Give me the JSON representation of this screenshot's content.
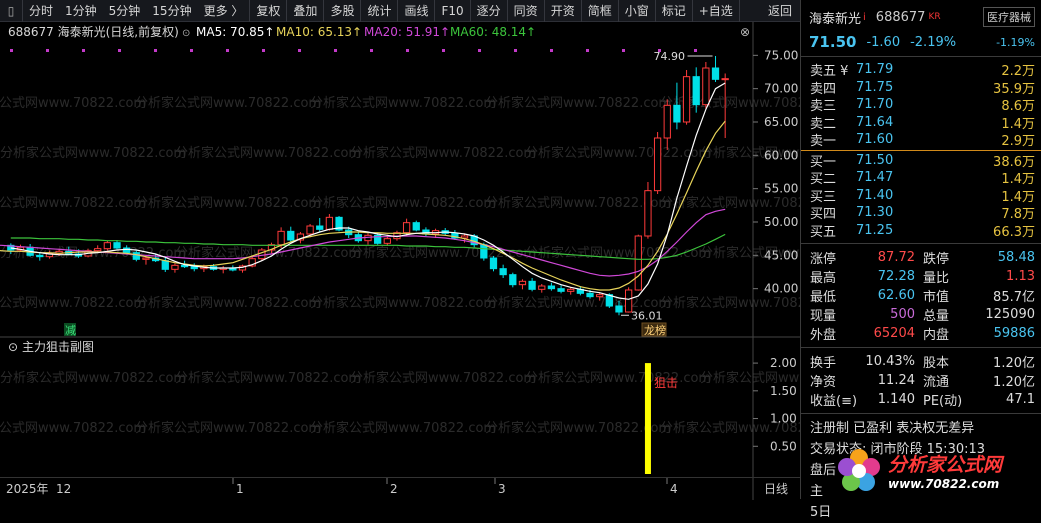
{
  "toolbar": {
    "items": [
      "分时",
      "1分钟",
      "5分钟",
      "15分钟",
      "更多 〉",
      "复权",
      "叠加",
      "多股",
      "统计",
      "画线",
      "F10",
      "逐分",
      "同资",
      "开资",
      "简框",
      "小窗",
      "标记",
      "+自选"
    ],
    "back": "返回"
  },
  "chart": {
    "title": "688677  海泰新光(日线,前复权)",
    "ma5": "MA5: 70.85↑",
    "ma10": "MA10: 65.13↑",
    "ma20": "MA20: 51.91↑",
    "ma60": "MA60: 48.14↑",
    "high_label": "74.90",
    "low_label": "36.01",
    "signal_label": "减",
    "badge_label": "龙榜",
    "watermark": "分析家公式网www.70822.com",
    "sub_title": "主力狙击副图",
    "sub_signal": "狙击",
    "time_labels": [
      "2025年",
      "12",
      "1",
      "2",
      "3",
      "4",
      "日线"
    ],
    "colors": {
      "up": "#ff3b3b",
      "down": "#00e0e8",
      "ma5": "#ffffff",
      "ma10": "#e8d45a",
      "ma20": "#d048d8",
      "ma60": "#3cc43c",
      "signal": "#ffff00"
    }
  },
  "chart_data": [
    {
      "type": "candlestick",
      "title": "688677 海泰新光(日线,前复权)",
      "xlabel": "",
      "ylabel": "",
      "ylim": [
        35,
        77
      ],
      "y_ticks": [
        40.0,
        45.0,
        50.0,
        55.0,
        60.0,
        65.0,
        70.0,
        75.0
      ],
      "x_ticks": [
        "2025年 12",
        "1",
        "2",
        "3",
        "4"
      ],
      "annotations": [
        {
          "label": "74.90",
          "value": 74.9
        },
        {
          "label": "36.01",
          "value": 36.01
        }
      ],
      "candles": [
        [
          46.5,
          46.8,
          45.2,
          45.8
        ],
        [
          45.8,
          46.6,
          45.5,
          46.2
        ],
        [
          46.2,
          46.7,
          44.8,
          45.0
        ],
        [
          45.0,
          45.5,
          44.2,
          44.8
        ],
        [
          44.8,
          45.7,
          44.5,
          45.3
        ],
        [
          45.3,
          46.0,
          44.9,
          45.6
        ],
        [
          45.6,
          46.3,
          45.1,
          45.2
        ],
        [
          45.2,
          45.9,
          44.6,
          44.9
        ],
        [
          44.9,
          46.0,
          44.7,
          45.7
        ],
        [
          45.7,
          46.5,
          45.4,
          46.0
        ],
        [
          46.0,
          47.2,
          45.7,
          46.9
        ],
        [
          46.9,
          47.3,
          45.9,
          46.1
        ],
        [
          46.1,
          46.5,
          45.1,
          45.4
        ],
        [
          45.4,
          45.7,
          44.1,
          44.4
        ],
        [
          44.4,
          45.0,
          43.6,
          44.6
        ],
        [
          44.6,
          45.2,
          44.0,
          44.2
        ],
        [
          44.2,
          44.6,
          42.5,
          42.9
        ],
        [
          42.9,
          43.8,
          42.4,
          43.5
        ],
        [
          43.5,
          44.2,
          43.1,
          43.3
        ],
        [
          43.3,
          43.8,
          42.6,
          43.0
        ],
        [
          43.0,
          43.6,
          42.5,
          43.3
        ],
        [
          43.3,
          43.7,
          42.7,
          42.9
        ],
        [
          42.9,
          43.4,
          42.3,
          43.1
        ],
        [
          43.1,
          43.5,
          42.6,
          42.8
        ],
        [
          42.8,
          43.6,
          42.4,
          43.4
        ],
        [
          43.4,
          44.8,
          43.2,
          44.5
        ],
        [
          44.5,
          46.1,
          44.2,
          45.8
        ],
        [
          45.8,
          46.9,
          45.3,
          46.6
        ],
        [
          46.6,
          49.2,
          46.1,
          48.6
        ],
        [
          48.6,
          49.3,
          47.0,
          47.3
        ],
        [
          47.3,
          48.5,
          46.8,
          48.2
        ],
        [
          48.2,
          49.7,
          47.7,
          49.4
        ],
        [
          49.4,
          50.6,
          48.5,
          48.9
        ],
        [
          48.9,
          51.2,
          48.7,
          50.7
        ],
        [
          50.7,
          50.9,
          48.6,
          48.8
        ],
        [
          48.8,
          49.3,
          47.6,
          48.1
        ],
        [
          48.1,
          48.6,
          46.9,
          47.2
        ],
        [
          47.2,
          48.3,
          46.6,
          48.0
        ],
        [
          48.0,
          48.4,
          46.6,
          46.8
        ],
        [
          46.8,
          48.1,
          46.4,
          47.5
        ],
        [
          47.5,
          48.7,
          47.2,
          48.4
        ],
        [
          48.4,
          50.5,
          47.9,
          49.9
        ],
        [
          49.9,
          50.2,
          48.6,
          48.8
        ],
        [
          48.8,
          49.2,
          47.9,
          48.2
        ],
        [
          48.2,
          49.0,
          47.6,
          48.7
        ],
        [
          48.7,
          49.1,
          48.0,
          48.3
        ],
        [
          48.3,
          48.8,
          47.3,
          47.6
        ],
        [
          47.6,
          48.3,
          46.9,
          47.9
        ],
        [
          47.9,
          48.2,
          46.2,
          46.6
        ],
        [
          46.6,
          46.9,
          44.2,
          44.6
        ],
        [
          44.6,
          44.9,
          42.6,
          43.0
        ],
        [
          43.0,
          43.6,
          41.6,
          42.1
        ],
        [
          42.1,
          42.4,
          40.2,
          40.6
        ],
        [
          40.6,
          41.4,
          39.9,
          41.1
        ],
        [
          41.1,
          41.6,
          39.6,
          39.9
        ],
        [
          39.9,
          40.7,
          39.4,
          40.4
        ],
        [
          40.4,
          40.9,
          39.7,
          40.0
        ],
        [
          40.0,
          40.5,
          39.3,
          39.6
        ],
        [
          39.6,
          40.2,
          39.1,
          39.9
        ],
        [
          39.9,
          40.4,
          39.0,
          39.3
        ],
        [
          39.3,
          39.8,
          38.5,
          38.8
        ],
        [
          38.8,
          39.4,
          38.2,
          39.1
        ],
        [
          39.1,
          39.3,
          37.1,
          37.4
        ],
        [
          37.4,
          38.2,
          36.01,
          36.5
        ],
        [
          36.5,
          40.2,
          36.4,
          39.8
        ],
        [
          39.8,
          48.1,
          39.7,
          47.9
        ],
        [
          47.9,
          56.0,
          47.5,
          54.7
        ],
        [
          54.7,
          63.5,
          54.2,
          62.6
        ],
        [
          62.6,
          68.4,
          60.8,
          67.5
        ],
        [
          67.5,
          70.9,
          63.9,
          65.0
        ],
        [
          65.0,
          72.8,
          64.6,
          71.8
        ],
        [
          71.8,
          73.2,
          66.4,
          67.6
        ],
        [
          67.6,
          74.0,
          67.0,
          73.1
        ],
        [
          73.1,
          74.9,
          71.0,
          71.4
        ],
        [
          71.4,
          72.28,
          62.6,
          71.5
        ]
      ],
      "ma5": [
        46.1,
        45.9,
        45.6,
        45.4,
        45.2,
        45.1,
        45.1,
        45.1,
        45.3,
        45.4,
        45.6,
        45.8,
        45.9,
        45.8,
        45.5,
        45.2,
        44.7,
        44.1,
        43.6,
        43.4,
        43.2,
        43.1,
        43.1,
        43.1,
        43.2,
        43.6,
        44.2,
        44.9,
        45.9,
        46.8,
        47.5,
        48.0,
        48.5,
        48.9,
        49.1,
        49.1,
        48.7,
        48.5,
        48.2,
        48.0,
        47.8,
        48.1,
        48.3,
        48.4,
        48.4,
        48.5,
        48.4,
        48.2,
        47.9,
        47.3,
        46.5,
        45.5,
        44.4,
        43.3,
        42.3,
        41.6,
        41.1,
        40.6,
        40.2,
        39.9,
        39.6,
        39.4,
        39.0,
        38.6,
        38.4,
        38.9,
        40.7,
        43.7,
        48.1,
        53.6,
        58.4,
        63.0,
        66.9,
        70.0,
        70.85
      ],
      "ma10": [
        45.9,
        45.9,
        45.8,
        45.7,
        45.6,
        45.6,
        45.5,
        45.4,
        45.4,
        45.3,
        45.4,
        45.5,
        45.5,
        45.5,
        45.5,
        45.4,
        45.3,
        45.1,
        44.8,
        44.5,
        44.2,
        43.9,
        43.7,
        43.5,
        43.4,
        43.5,
        43.7,
        43.9,
        44.4,
        44.9,
        45.4,
        45.9,
        46.5,
        47.0,
        47.5,
        47.8,
        48.1,
        48.3,
        48.4,
        48.5,
        48.5,
        48.4,
        48.4,
        48.3,
        48.3,
        48.3,
        48.3,
        48.2,
        48.1,
        48.0,
        47.8,
        47.5,
        47.1,
        46.6,
        46.0,
        45.3,
        44.6,
        43.8,
        43.1,
        42.5,
        41.9,
        41.3,
        40.8,
        40.3,
        40.0,
        39.8,
        39.8,
        40.1,
        40.8,
        41.9,
        43.5,
        45.6,
        48.2,
        51.2,
        54.4,
        57.6,
        60.7,
        63.3,
        65.13
      ],
      "ma20": [
        46.6,
        46.6,
        46.5,
        46.5,
        46.4,
        46.3,
        46.2,
        46.1,
        46.0,
        45.9,
        45.8,
        45.7,
        45.6,
        45.5,
        45.4,
        45.3,
        45.2,
        45.1,
        45.0,
        44.9,
        44.8,
        44.7,
        44.6,
        44.5,
        44.5,
        44.5,
        44.5,
        44.5,
        44.6,
        44.8,
        45.0,
        45.2,
        45.5,
        45.8,
        46.1,
        46.4,
        46.7,
        47.0,
        47.2,
        47.4,
        47.6,
        47.7,
        47.8,
        47.8,
        47.9,
        47.9,
        47.9,
        47.8,
        47.7,
        47.6,
        47.4,
        47.2,
        46.9,
        46.6,
        46.3,
        45.9,
        45.5,
        45.1,
        44.7,
        44.3,
        43.9,
        43.5,
        43.1,
        42.7,
        42.3,
        42.0,
        41.9,
        42.0,
        42.2,
        42.6,
        43.3,
        44.3,
        45.6,
        47.0,
        48.5,
        49.9,
        51.1,
        51.6,
        51.91
      ],
      "ma60": [
        47.6,
        47.6,
        47.6,
        47.5,
        47.5,
        47.5,
        47.4,
        47.4,
        47.3,
        47.3,
        47.2,
        47.2,
        47.1,
        47.1,
        47.0,
        47.0,
        46.9,
        46.9,
        46.8,
        46.8,
        46.7,
        46.7,
        46.6,
        46.6,
        46.6,
        46.5,
        46.5,
        46.5,
        46.5,
        46.5,
        46.5,
        46.5,
        46.5,
        46.5,
        46.5,
        46.5,
        46.5,
        46.5,
        46.5,
        46.5,
        46.5,
        46.4,
        46.4,
        46.4,
        46.3,
        46.3,
        46.2,
        46.2,
        46.1,
        46.0,
        45.9,
        45.8,
        45.7,
        45.6,
        45.5,
        45.4,
        45.3,
        45.2,
        45.1,
        45.0,
        44.9,
        44.8,
        44.7,
        44.6,
        44.5,
        44.4,
        44.4,
        44.5,
        44.7,
        45.0,
        45.5,
        46.1,
        46.7,
        47.4,
        48.14
      ]
    },
    {
      "type": "bar",
      "title": "主力狙击副图",
      "xlabel": "",
      "ylabel": "",
      "ylim": [
        0,
        2.2
      ],
      "y_ticks": [
        0.5,
        1.0,
        1.5,
        2.0
      ],
      "series": [
        {
          "name": "狙击",
          "index": 66,
          "value": 2.0
        }
      ]
    }
  ],
  "quote": {
    "name": "海泰新光",
    "code": "688677",
    "kr": "KR",
    "sector": "医疗器械",
    "price": "71.50",
    "change": "-1.60",
    "pct": "-2.19%",
    "sector_pct": "-1.19%",
    "asks": [
      {
        "label": "卖五 ¥",
        "price": "71.79",
        "vol": "2.2万"
      },
      {
        "label": "卖四",
        "price": "71.75",
        "vol": "35.9万"
      },
      {
        "label": "卖三",
        "price": "71.70",
        "vol": "8.6万"
      },
      {
        "label": "卖二",
        "price": "71.64",
        "vol": "1.4万"
      },
      {
        "label": "卖一",
        "price": "71.60",
        "vol": "2.9万"
      }
    ],
    "bids": [
      {
        "label": "买一",
        "price": "71.50",
        "vol": "38.6万"
      },
      {
        "label": "买二",
        "price": "71.47",
        "vol": "1.4万"
      },
      {
        "label": "买三",
        "price": "71.40",
        "vol": "1.4万"
      },
      {
        "label": "买四",
        "price": "71.30",
        "vol": "7.8万"
      },
      {
        "label": "买五",
        "price": "71.25",
        "vol": "66.3万"
      }
    ],
    "stats": [
      {
        "l1": "涨停",
        "v1": "87.72",
        "c1": "red",
        "l2": "跌停",
        "v2": "58.48",
        "c2": "cyan"
      },
      {
        "l1": "最高",
        "v1": "72.28",
        "c1": "cyan",
        "l2": "量比",
        "v2": "1.13",
        "c2": "red"
      },
      {
        "l1": "最低",
        "v1": "62.60",
        "c1": "cyan",
        "l2": "市值",
        "v2": "85.7亿",
        "c2": "white"
      },
      {
        "l1": "现量",
        "v1": "500",
        "c1": "purple",
        "l2": "总量",
        "v2": "125090",
        "c2": "white"
      },
      {
        "l1": "外盘",
        "v1": "65204",
        "c1": "red",
        "l2": "内盘",
        "v2": "59886",
        "c2": "cyan"
      }
    ],
    "stats2": [
      {
        "l1": "换手",
        "v1": "10.43%",
        "l2": "股本",
        "v2": "1.20亿"
      },
      {
        "l1": "净资",
        "v1": "11.24",
        "l2": "流通",
        "v2": "1.20亿"
      },
      {
        "l1": "收益(≡)",
        "v1": "1.140",
        "l2": "PE(动)",
        "v2": "47.1"
      }
    ],
    "info_tags": "注册制 已盈利 表决权无差异",
    "trade_status": "交易状态: 闭市阶段 15:30:13",
    "row_pan": "盘后",
    "row_zhu": "主",
    "row_five": "5日"
  },
  "logo": {
    "text": "分析家公式网",
    "url": "www.70822.com"
  }
}
